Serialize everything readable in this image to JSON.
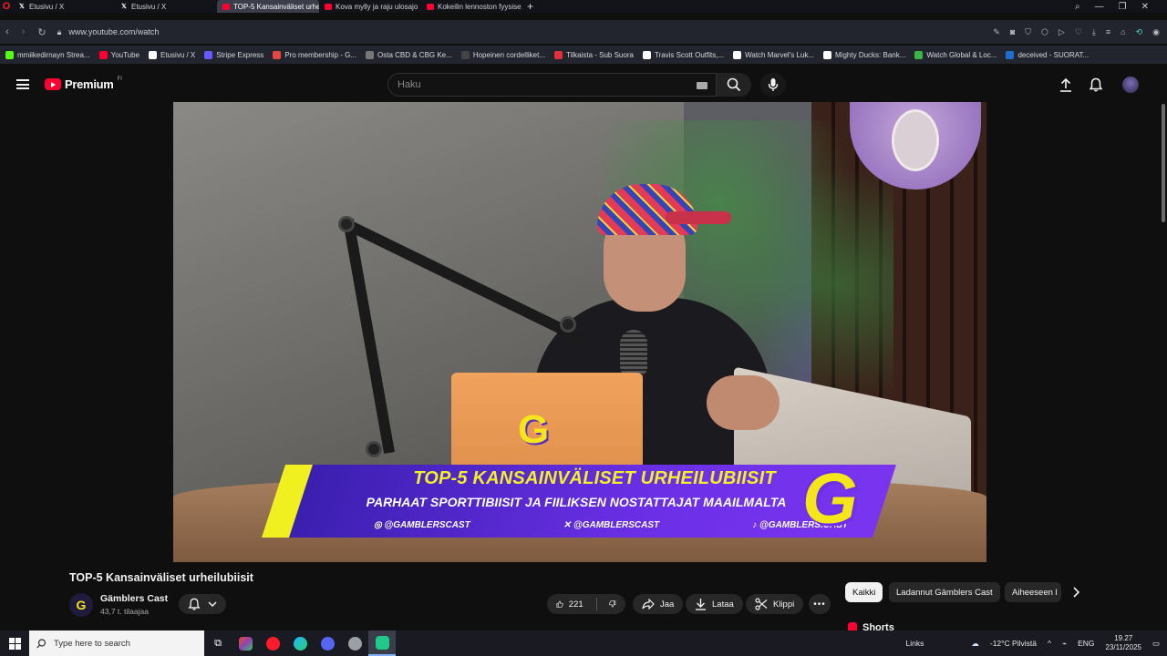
{
  "browser": {
    "tabs": [
      {
        "label": "Etusivu / X",
        "favicon": "x-logo-icon",
        "active": false
      },
      {
        "label": "Etusivu / X",
        "favicon": "x-logo-icon",
        "active": false
      },
      {
        "label": "TOP-5 Kansainväliset urhe",
        "favicon": "youtube-icon",
        "active": true
      },
      {
        "label": "Kova mylly ja raju ulosajo",
        "favicon": "youtube-icon",
        "active": false
      },
      {
        "label": "Kokeilin lennoston fyysise",
        "favicon": "youtube-icon",
        "active": false
      }
    ],
    "url": "www.youtube.com/watch",
    "bookmarks": [
      {
        "label": "mmiikedirnayn Strea...",
        "color": "#53fc18"
      },
      {
        "label": "YouTube",
        "color": "#ff0033"
      },
      {
        "label": "Etusivu / X",
        "color": "#ffffff"
      },
      {
        "label": "Stripe Express",
        "color": "#635bff"
      },
      {
        "label": "Pro membership - G...",
        "color": "#e64545"
      },
      {
        "label": "Osta CBD & CBG Ke...",
        "color": "#777777"
      },
      {
        "label": "Hopeinen cordelliket...",
        "color": "#444444"
      },
      {
        "label": "Tilkaista - Sub Suora",
        "color": "#e0303a"
      },
      {
        "label": "Travis Scott Outfits,...",
        "color": "#ffffff"
      },
      {
        "label": "Watch Marvel's Luk...",
        "color": "#ffffff"
      },
      {
        "label": "Mighty Ducks: Bank...",
        "color": "#ffffff"
      },
      {
        "label": "Watch Global & Loc...",
        "color": "#3bb54a"
      },
      {
        "label": "deceived - SUORAT...",
        "color": "#1c6fd0"
      }
    ]
  },
  "youtube": {
    "logo_text": "Premium",
    "region": "FI",
    "search_placeholder": "Haku"
  },
  "video": {
    "banner_title": "TOP-5 KANSAINVÄLISET URHEILUBIISIT",
    "banner_subtitle": "PARHAAT SPORTTIBIISIT JA FIILIKSEN NOSTATTAJAT MAAILMALTA",
    "social_instagram": "@GAMBLERSCAST",
    "social_x": "@GAMBLERSCAST",
    "social_tiktok": "@GAMBLERS.CAST",
    "logo_letter": "G"
  },
  "watch": {
    "title": "TOP-5 Kansainväliset urheilubiisit",
    "channel_name": "Gämblers Cast",
    "channel_avatar_letter": "G",
    "subscribers": "43,7 t. tilaajaa",
    "likes": "221",
    "share_label": "Jaa",
    "download_label": "Lataa",
    "clip_label": "Klippi",
    "more_label": "•••"
  },
  "chips": [
    {
      "label": "Kaikki",
      "active": true
    },
    {
      "label": "Ladannut Gämblers Cast",
      "active": false
    },
    {
      "label": "Aiheeseen l",
      "active": false
    }
  ],
  "shorts_label": "Shorts",
  "taskbar": {
    "search_placeholder": "Type here to search",
    "links_label": "Links",
    "weather": "-12°C  Pilvistä",
    "language": "ENG",
    "time": "19.27",
    "date": "23/11/2025"
  }
}
